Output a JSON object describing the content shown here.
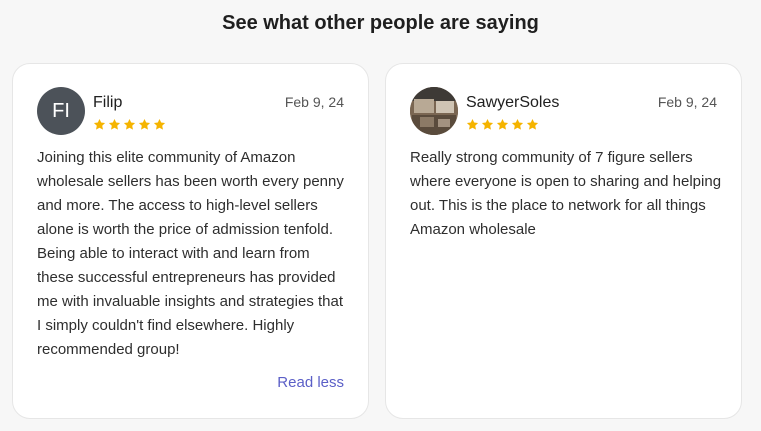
{
  "heading": "See what other people are saying",
  "colors": {
    "star": "#f5b400",
    "link": "#5b5fc7",
    "avatar_bg": "#4c5259"
  },
  "reviews": [
    {
      "avatar_initials": "FI",
      "name": "Filip",
      "date": "Feb 9, 24",
      "rating": 5,
      "text": "Joining this elite community of Amazon wholesale sellers has been worth every penny and more. The access to high-level sellers alone is worth the price of admission tenfold. Being able to interact with and learn from these successful entrepreneurs has provided me with invaluable insights and strategies that I simply couldn't find elsewhere. Highly recommended group!",
      "toggle_label": "Read less"
    },
    {
      "avatar_image": "photo",
      "name": "SawyerSoles",
      "date": "Feb 9, 24",
      "rating": 5,
      "text": "Really strong community of 7 figure sellers where everyone is open to sharing and helping out. This is the place to network for all things Amazon wholesale"
    }
  ]
}
